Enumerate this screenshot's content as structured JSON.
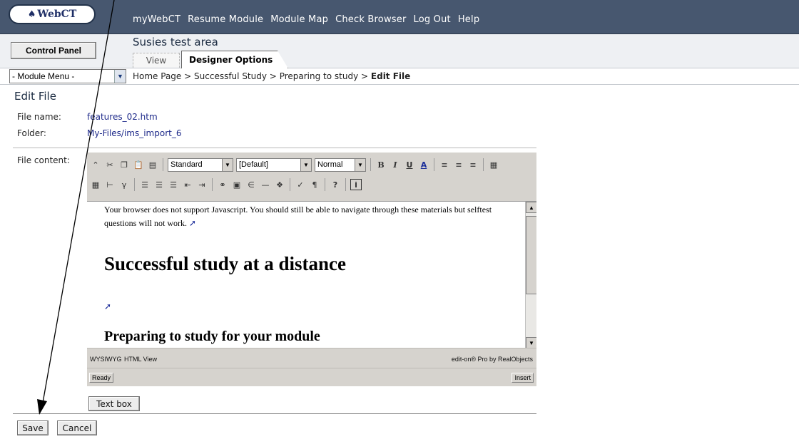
{
  "header": {
    "logo_text": "WebCT",
    "nav": [
      "myWebCT",
      "Resume Module",
      "Module Map",
      "Check Browser",
      "Log Out",
      "Help"
    ],
    "control_panel": "Control Panel",
    "area_title": "Susies test area",
    "tabs": {
      "view": "View",
      "designer": "Designer Options"
    },
    "module_menu": "- Module Menu -"
  },
  "breadcrumb": {
    "items": [
      "Home Page",
      "Successful Study",
      "Preparing to study"
    ],
    "separator": ">",
    "current": "Edit File"
  },
  "form": {
    "title": "Edit File",
    "file_name_label": "File name:",
    "file_name_value": "features_02.htm",
    "folder_label": "Folder:",
    "folder_value": "My-Files/ims_import_6",
    "content_label": "File content:"
  },
  "editor": {
    "style_select": "Standard",
    "font_select": "[Default]",
    "size_select": "Normal",
    "content": {
      "notice": "Your browser does not support Javascript. You should still be able to navigate through these materials but selftest questions will not work.",
      "heading1": "Successful study at a distance",
      "heading2": "Preparing to study for your module"
    },
    "modes": {
      "wysiwyg": "WYSIWYG",
      "html": "HTML View",
      "brand": "edit-on® Pro by RealObjects"
    },
    "status": {
      "ready": "Ready",
      "insert": "Insert"
    }
  },
  "buttons": {
    "text_box": "Text box",
    "save": "Save",
    "cancel": "Cancel"
  },
  "colors": {
    "topbar": "#47576f",
    "link": "#1e2a8a",
    "toolbar": "#d6d3ce"
  }
}
